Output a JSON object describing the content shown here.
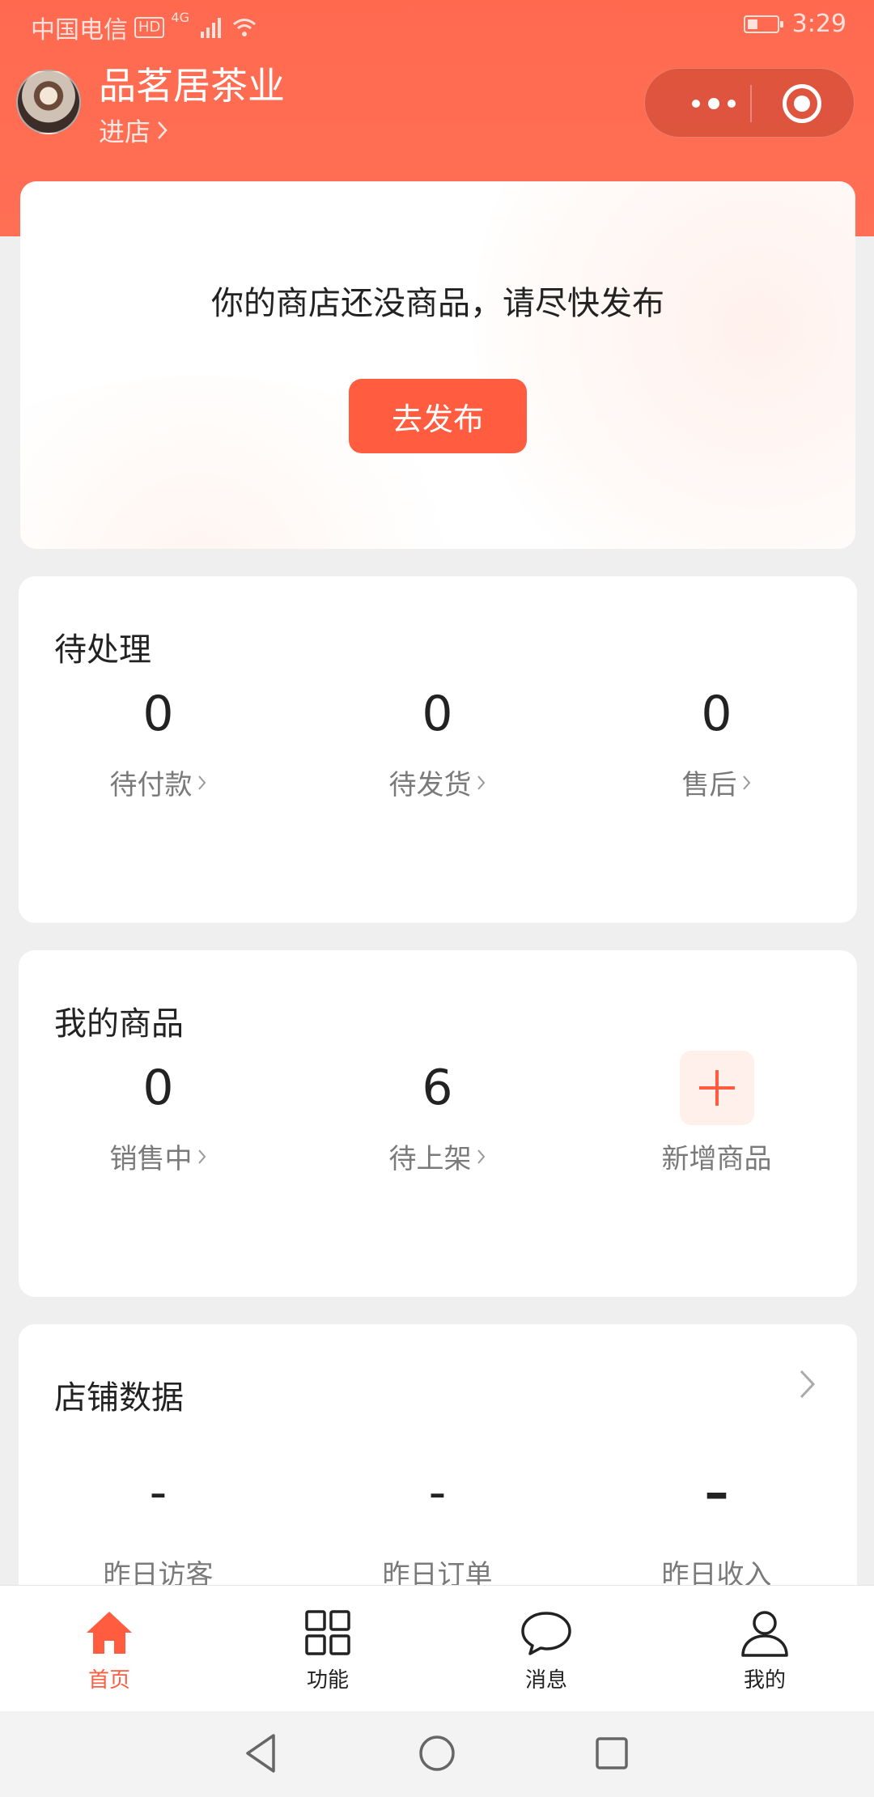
{
  "status_bar": {
    "carrier": "中国电信",
    "hd": "HD",
    "network": "4G",
    "time": "3:29"
  },
  "shop": {
    "name": "品茗居茶业",
    "enter_label": "进店"
  },
  "promo": {
    "message": "你的商店还没商品，请尽快发布",
    "button_label": "去发布"
  },
  "pending": {
    "title": "待处理",
    "items": [
      {
        "value": "0",
        "label": "待付款"
      },
      {
        "value": "0",
        "label": "待发货"
      },
      {
        "value": "0",
        "label": "售后"
      }
    ]
  },
  "goods": {
    "title": "我的商品",
    "items": [
      {
        "value": "0",
        "label": "销售中"
      },
      {
        "value": "6",
        "label": "待上架"
      }
    ],
    "add_label": "新增商品"
  },
  "shop_data": {
    "title": "店铺数据",
    "items": [
      {
        "value": "-",
        "label": "昨日访客"
      },
      {
        "value": "-",
        "label": "昨日订单"
      },
      {
        "value": "–",
        "label": "昨日收入"
      }
    ]
  },
  "tabbar": {
    "items": [
      {
        "label": "首页",
        "icon": "home-icon",
        "active": true
      },
      {
        "label": "功能",
        "icon": "grid-icon"
      },
      {
        "label": "消息",
        "icon": "message-icon"
      },
      {
        "label": "我的",
        "icon": "user-icon"
      }
    ]
  },
  "colors": {
    "brand": "#ff5c40",
    "header": "#ff6a4f",
    "page_bg": "#efefef"
  }
}
